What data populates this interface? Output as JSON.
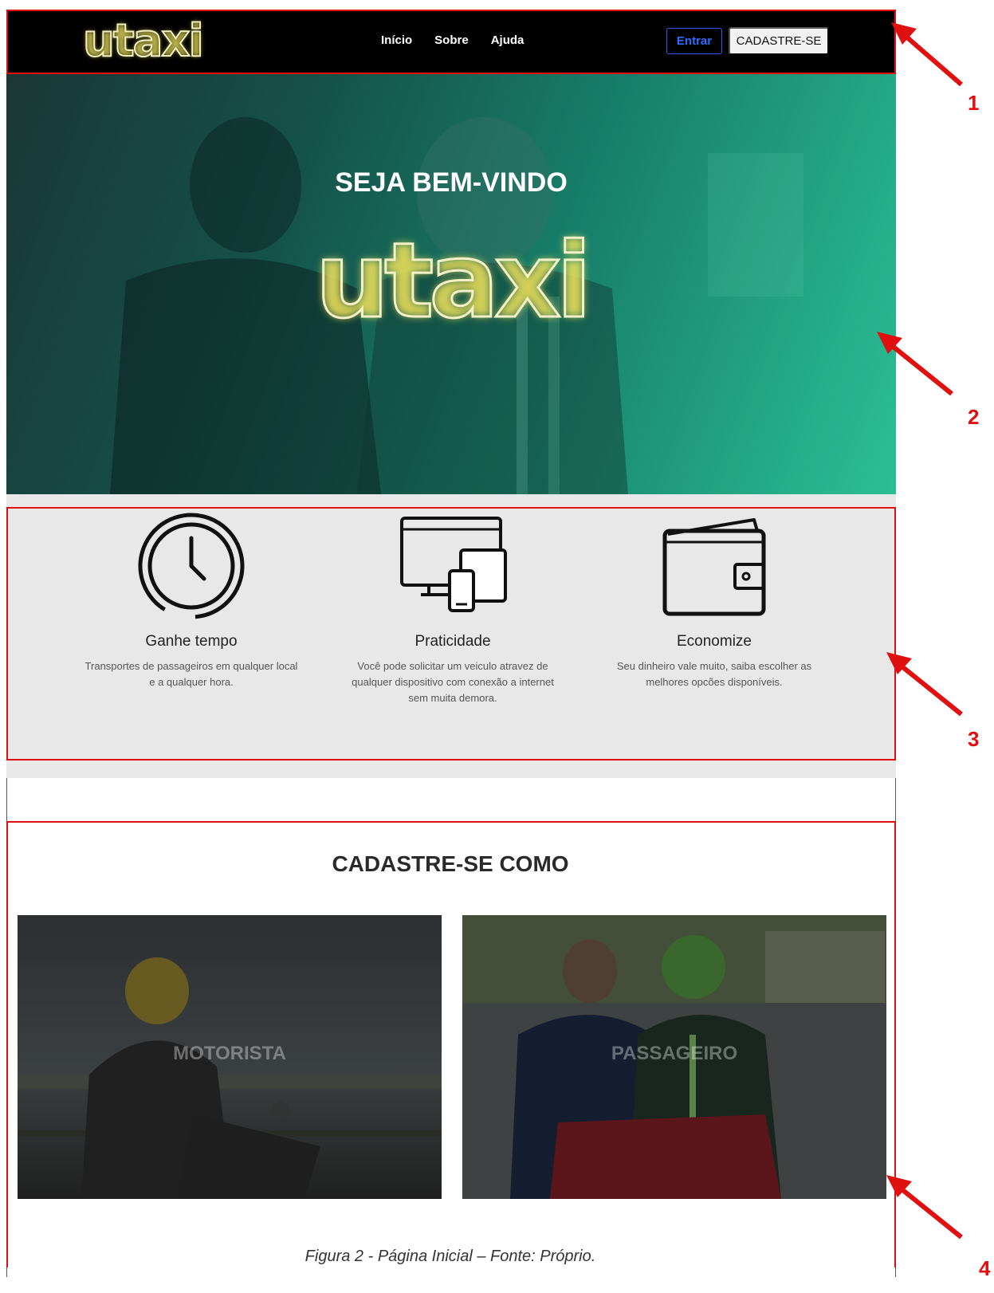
{
  "navbar": {
    "logo": "utaxi",
    "links": [
      "Início",
      "Sobre",
      "Ajuda"
    ],
    "login_label": "Entrar",
    "signup_label": "CADASTRE-SE"
  },
  "hero": {
    "subtitle": "SEJA BEM-VINDO",
    "logo": "utaxi"
  },
  "features": [
    {
      "icon": "clock-icon",
      "title": "Ganhe tempo",
      "desc": "Transportes de passageiros em qualquer local e a qualquer hora."
    },
    {
      "icon": "devices-icon",
      "title": "Praticidade",
      "desc": "Você pode solicitar um veiculo atravez de qualquer dispositivo com conexão a internet sem muita demora."
    },
    {
      "icon": "wallet-icon",
      "title": "Economize",
      "desc": "Seu dinheiro vale muito, saiba escolher as melhores opcões disponíveis."
    }
  ],
  "register": {
    "title": "CADASTRE-SE COMO",
    "options": [
      "MOTORISTA",
      "PASSAGEIRO"
    ]
  },
  "annotations": [
    "1",
    "2",
    "3",
    "4"
  ],
  "caption": "Figura 2 - Página Inicial – Fonte: Próprio.",
  "colors": {
    "annotation": "#e01010",
    "navbar": "#000000",
    "hero_start": "#1e3b3a",
    "hero_end": "#2fd0a2",
    "features_bg": "#e8e8e8",
    "login_border": "#2b5bff"
  }
}
